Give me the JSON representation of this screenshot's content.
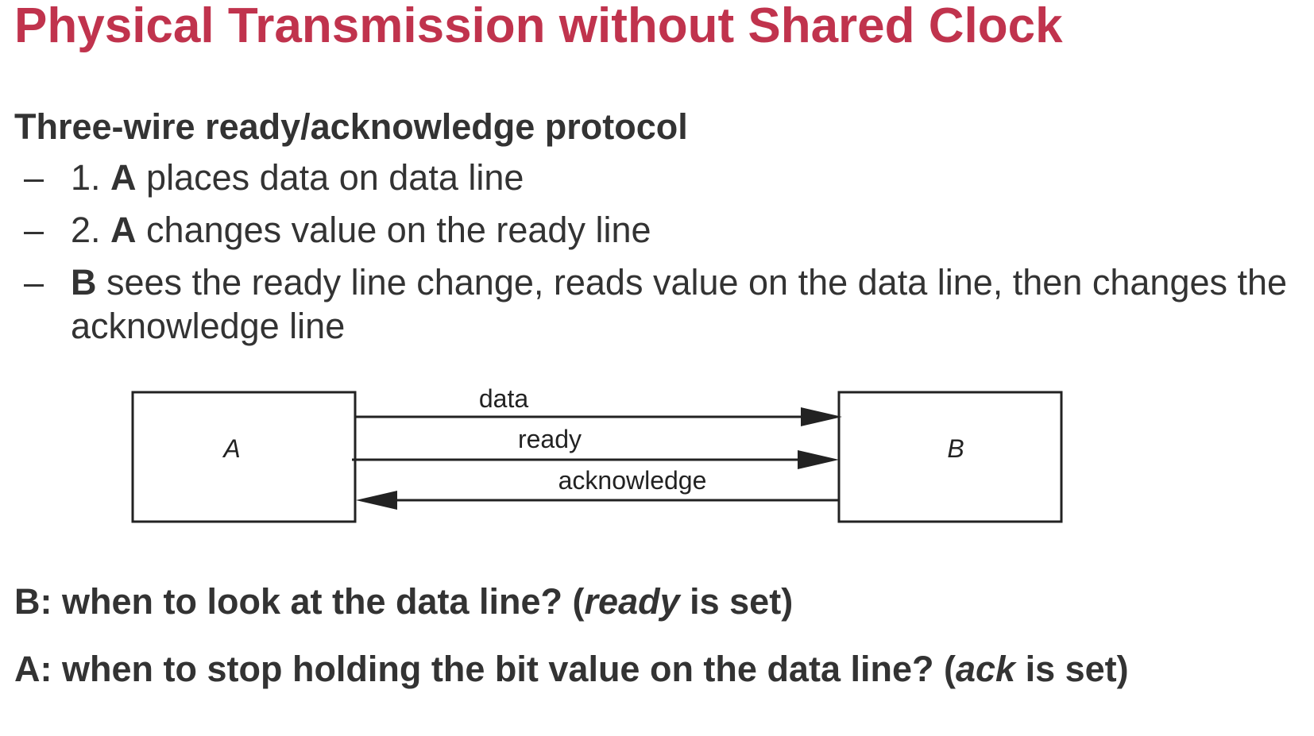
{
  "title": "Physical Transmission without Shared Clock",
  "heading": "Three-wire ready/acknowledge protocol",
  "bullets": [
    {
      "dash": "–",
      "prefix": "1. ",
      "bold": "A",
      "rest": " places data on data line"
    },
    {
      "dash": "–",
      "prefix": "2. ",
      "bold": "A",
      "rest": " changes value on the ready line"
    },
    {
      "dash": "–",
      "prefix": "",
      "bold": "B",
      "rest": " sees the ready line change, reads value on the data line, then changes the acknowledge line"
    }
  ],
  "diagram": {
    "node_a": "A",
    "node_b": "B",
    "line_data": "data",
    "line_ready": "ready",
    "line_ack": "acknowledge",
    "stroke_color": "#222222"
  },
  "questions": [
    {
      "lead": "B: when to look at the data line? (",
      "italic": "ready",
      "tail": " is set)"
    },
    {
      "lead": "A: when to stop holding the bit value on the data line? (",
      "italic": "ack",
      "tail": " is set)"
    }
  ],
  "colors": {
    "title": "#c0334d",
    "text": "#333333"
  }
}
